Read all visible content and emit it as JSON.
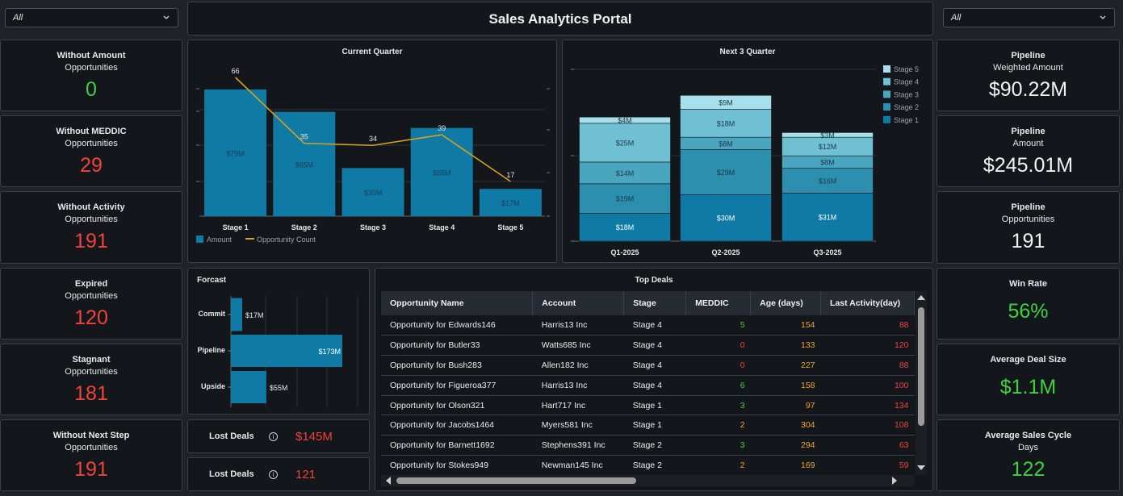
{
  "header": {
    "title": "Sales Analytics Portal",
    "left_filter": "All",
    "right_filter": "All"
  },
  "left_kpis": [
    {
      "title": "Without Amount",
      "subtitle": "Opportunities",
      "value": "0",
      "color": "green"
    },
    {
      "title": "Without MEDDIC",
      "subtitle": "Opportunities",
      "value": "29",
      "color": "red"
    },
    {
      "title": "Without Activity",
      "subtitle": "Opportunities",
      "value": "191",
      "color": "red"
    },
    {
      "title": "Expired",
      "subtitle": "Opportunities",
      "value": "120",
      "color": "red"
    },
    {
      "title": "Stagnant",
      "subtitle": "Opportunities",
      "value": "181",
      "color": "red"
    },
    {
      "title": "Without Next Step",
      "subtitle": "Opportunities",
      "value": "191",
      "color": "red"
    }
  ],
  "right_kpis": [
    {
      "title": "Pipeline",
      "subtitle": "Weighted  Amount",
      "value": "$90.22M",
      "color": "white"
    },
    {
      "title": "Pipeline",
      "subtitle": "Amount",
      "value": "$245.01M",
      "color": "white"
    },
    {
      "title": "Pipeline",
      "subtitle": "Opportunities",
      "value": "191",
      "color": "white"
    },
    {
      "title": "Win Rate",
      "subtitle": "",
      "value": "56%",
      "color": "green"
    },
    {
      "title": "Average Deal Size",
      "subtitle": "",
      "value": "$1.1M",
      "color": "green"
    },
    {
      "title": "Average Sales Cycle",
      "subtitle": "Days",
      "value": "122",
      "color": "green"
    }
  ],
  "lost_deals": [
    {
      "label": "Lost Deals",
      "value": "$145M"
    },
    {
      "label": "Lost Deals",
      "value": "121"
    }
  ],
  "colors": {
    "bar": "#0e7aa5",
    "line": "#d9a21b",
    "stage1": "#0e7aa5",
    "stage2": "#2c8fae",
    "stage3": "#4aa6bf",
    "stage4": "#6fc0d2",
    "stage5": "#a6e0ea"
  },
  "chart_data": [
    {
      "type": "bar",
      "title": "Current Quarter",
      "categories": [
        "Stage 1",
        "Stage 2",
        "Stage 3",
        "Stage 4",
        "Stage 5"
      ],
      "series": [
        {
          "name": "Amount",
          "values": [
            79,
            65,
            30,
            55,
            17
          ],
          "labels": [
            "$79M",
            "$65M",
            "$30M",
            "$55M",
            "$17M"
          ]
        },
        {
          "name": "Opportunity Count",
          "type": "line",
          "values": [
            66,
            35,
            34,
            39,
            17
          ]
        }
      ],
      "legend": "bottom-left"
    },
    {
      "type": "bar",
      "stacked": true,
      "title": "Next 3 Quarter",
      "categories": [
        "Q1-2025",
        "Q2-2025",
        "Q3-2025"
      ],
      "series": [
        {
          "name": "Stage 1",
          "values": [
            18,
            30,
            31
          ]
        },
        {
          "name": "Stage 2",
          "values": [
            19,
            29,
            16
          ]
        },
        {
          "name": "Stage 3",
          "values": [
            14,
            8,
            8
          ]
        },
        {
          "name": "Stage 4",
          "values": [
            25,
            18,
            12
          ]
        },
        {
          "name": "Stage 5",
          "values": [
            4,
            9,
            3
          ]
        }
      ],
      "legend": "top-right"
    },
    {
      "type": "bar",
      "orientation": "horizontal",
      "title": "Forcast",
      "categories": [
        "Commit",
        "Pipeline",
        "Upside"
      ],
      "values": [
        17,
        173,
        55
      ],
      "labels": [
        "$17M",
        "$173M",
        "$55M"
      ]
    }
  ],
  "top_deals": {
    "title": "Top Deals",
    "columns": [
      "Opportunity Name",
      "Account",
      "Stage",
      "MEDDIC",
      "Age (days)",
      "Last Activity(day)"
    ],
    "rows": [
      [
        "Opportunity for Edwards146",
        "Harris13 Inc",
        "Stage 4",
        "5",
        "154",
        "88"
      ],
      [
        "Opportunity for Butler33",
        "Watts685 Inc",
        "Stage 4",
        "0",
        "133",
        "120"
      ],
      [
        "Opportunity for Bush283",
        "Allen182 Inc",
        "Stage 4",
        "0",
        "227",
        "88"
      ],
      [
        "Opportunity for Figueroa377",
        "Harris13 Inc",
        "Stage 4",
        "6",
        "158",
        "100"
      ],
      [
        "Opportunity for Olson321",
        "Hart717 Inc",
        "Stage 1",
        "3",
        "97",
        "134"
      ],
      [
        "Opportunity for Jacobs1464",
        "Myers581 Inc",
        "Stage 1",
        "2",
        "304",
        "108"
      ],
      [
        "Opportunity for Barnett1692",
        "Stephens391 Inc",
        "Stage 2",
        "3",
        "294",
        "63"
      ],
      [
        "Opportunity for Stokes949",
        "Newman145 Inc",
        "Stage 2",
        "2",
        "169",
        "59"
      ]
    ],
    "meddic_colors": [
      "green",
      "red",
      "red",
      "green",
      "green",
      "orange",
      "green",
      "orange"
    ]
  }
}
